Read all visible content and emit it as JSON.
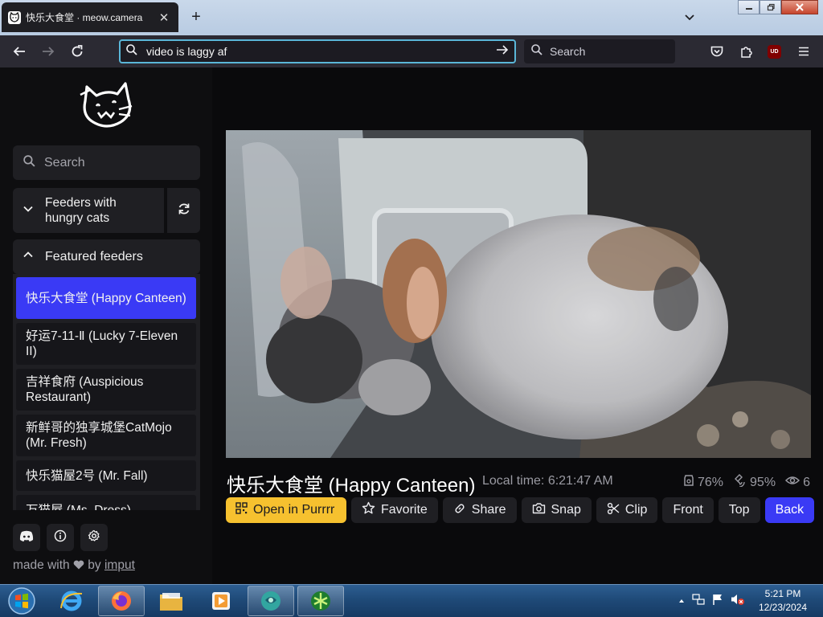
{
  "browser": {
    "tab_title": "快乐大食堂 · meow.camera",
    "url_text": "video is laggy af",
    "search_placeholder": "Search",
    "ublock_label": "UD"
  },
  "sidebar": {
    "search_placeholder": "Search",
    "feeder_group_label": "Feeders with hungry cats",
    "featured_label": "Featured feeders",
    "feeders": [
      {
        "label": "快乐大食堂 (Happy Canteen)",
        "active": true
      },
      {
        "label": "好运7-11-Ⅱ (Lucky 7-Eleven II)",
        "active": false
      },
      {
        "label": "吉祥食府 (Auspicious Restaurant)",
        "active": false
      },
      {
        "label": "新鲜哥的独享城堡CatMojo (Mr. Fresh)",
        "active": false
      },
      {
        "label": "快乐猫屋2号 (Mr. Fall)",
        "active": false
      },
      {
        "label": "万猫屋 (Ms. Dress)",
        "active": false
      }
    ],
    "footer": {
      "made_with": "made with",
      "by": "by",
      "author": "imput"
    }
  },
  "main": {
    "camera_title": "快乐大食堂 (Happy Canteen)",
    "local_time": "Local time: 6:21:47 AM",
    "stats": {
      "food_level": "76%",
      "signal": "95%",
      "viewers": "6"
    },
    "actions": {
      "open": "Open in Purrrr",
      "favorite": "Favorite",
      "share": "Share",
      "snap": "Snap",
      "clip": "Clip",
      "front": "Front",
      "top": "Top",
      "back": "Back"
    }
  },
  "taskbar": {
    "time": "5:21 PM",
    "date": "12/23/2024"
  },
  "colors": {
    "accent_blue": "#3a3af5",
    "accent_yellow": "#f6c12f",
    "url_focus": "#5ab6d8"
  }
}
